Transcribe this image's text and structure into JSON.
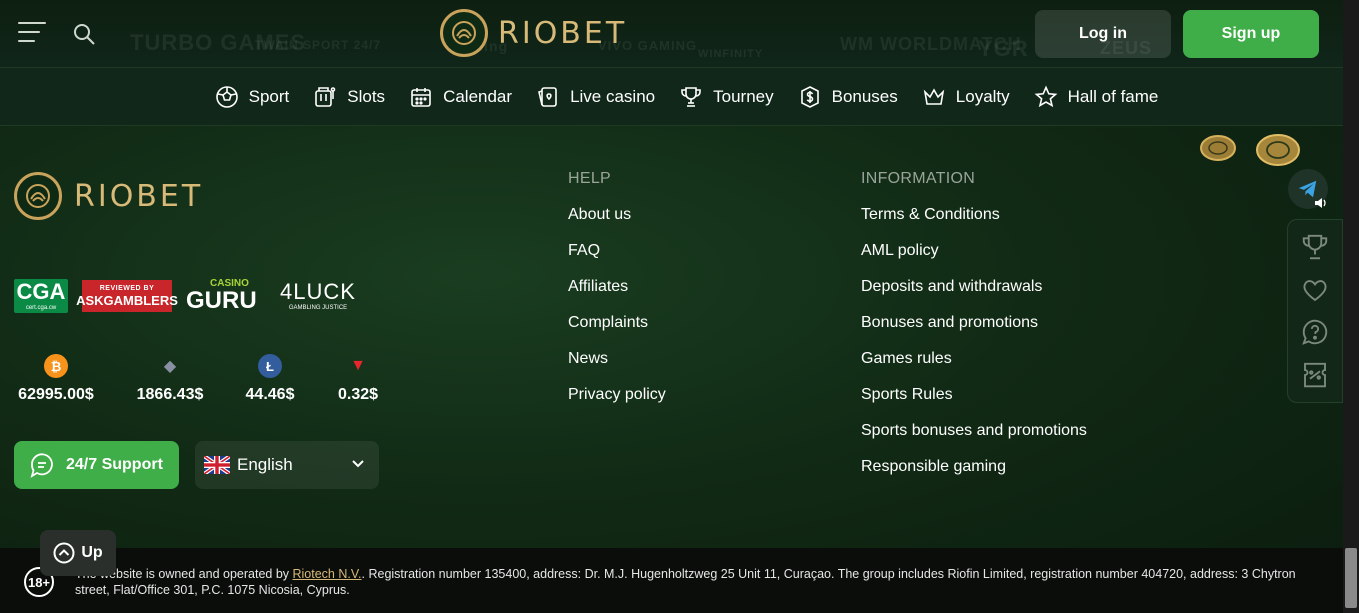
{
  "header": {
    "brand": "RIOBET",
    "login_label": "Log in",
    "signup_label": "Sign up",
    "provider_logos": [
      "TURBO GAMES",
      "TWAIN SPORT 24/7",
      "Gaming",
      "VIVO GAMING",
      "WINFINITY",
      "WM WORLDMATCH",
      "YGR",
      "ZEUS"
    ]
  },
  "nav": {
    "items": [
      {
        "label": "Sport",
        "icon": "soccer-ball-icon"
      },
      {
        "label": "Slots",
        "icon": "slot-machine-icon"
      },
      {
        "label": "Calendar",
        "icon": "calendar-icon"
      },
      {
        "label": "Live casino",
        "icon": "live-cards-icon"
      },
      {
        "label": "Tourney",
        "icon": "trophy-icon"
      },
      {
        "label": "Bonuses",
        "icon": "dollar-coin-icon"
      },
      {
        "label": "Loyalty",
        "icon": "crown-icon"
      },
      {
        "label": "Hall of fame",
        "icon": "star-icon"
      }
    ]
  },
  "footer": {
    "brand": "RIOBET",
    "badges": {
      "cga": "CGA",
      "cga_sub": "cert.cga.cw",
      "ask_small": "REVIEWED BY",
      "ask_big": "ASKGAMBLERS",
      "guru_small": "CASINO",
      "guru_big": "GURU",
      "luck_big": "4LUCK",
      "luck_small": "GAMBLING JUSTICE"
    },
    "crypto": [
      {
        "symbol": "₿",
        "price": "62995.00$",
        "color": "#f7931a"
      },
      {
        "symbol": "◆",
        "price": "1866.43$",
        "color": "#6b7080"
      },
      {
        "symbol": "Ł",
        "price": "44.46$",
        "color": "#345d9d"
      },
      {
        "symbol": "▼",
        "price": "0.32$",
        "color": "#e5272d"
      }
    ],
    "support_label": "24/7 Support",
    "language": "English",
    "help": {
      "heading": "HELP",
      "links": [
        "About us",
        "FAQ",
        "Affiliates",
        "Complaints",
        "News",
        "Privacy policy"
      ]
    },
    "information": {
      "heading": "INFORMATION",
      "links": [
        "Terms & Conditions",
        "AML policy",
        "Deposits and withdrawals",
        "Bonuses and promotions",
        "Games rules",
        "Sports Rules",
        "Sports bonuses and promotions",
        "Responsible gaming"
      ]
    },
    "up_label": "Up",
    "age": "18+",
    "legal_prefix": "The website is owned and operated by ",
    "legal_link": "Riotech N.V.",
    "legal_suffix": ". Registration number 135400, address: Dr. M.J. Hugenholtzweg 25 Unit 11, Curaçao. The group includes Riofin Limited, registration number 404720, address: 3 Chytron street, Flat/Office 301, P.C. 1075 Nicosia, Cyprus."
  },
  "colors": {
    "accent_green": "#3fae49",
    "brand_gold": "#d7b978"
  }
}
